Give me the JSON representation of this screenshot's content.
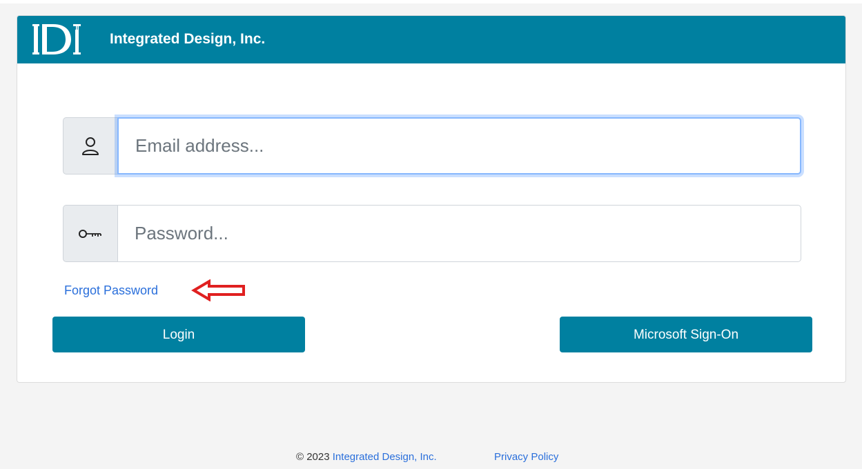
{
  "header": {
    "logo_text": "IDI",
    "title": "Integrated Design, Inc.",
    "color": "#0080a0"
  },
  "form": {
    "email": {
      "placeholder": "Email address...",
      "value": "",
      "icon": "user-icon"
    },
    "password": {
      "placeholder": "Password...",
      "value": "",
      "icon": "key-icon"
    },
    "forgot_label": "Forgot Password",
    "annotation": "red-arrow-icon",
    "login_label": "Login",
    "microsoft_label": "Microsoft Sign-On"
  },
  "footer": {
    "copyright": "© 2023 ",
    "company_link": "Integrated Design, Inc.",
    "privacy_link": "Privacy Policy"
  },
  "colors": {
    "accent": "#0080a0",
    "link": "#2a6fdb",
    "annotation": "#e02020",
    "focus": "#86b7fe"
  }
}
